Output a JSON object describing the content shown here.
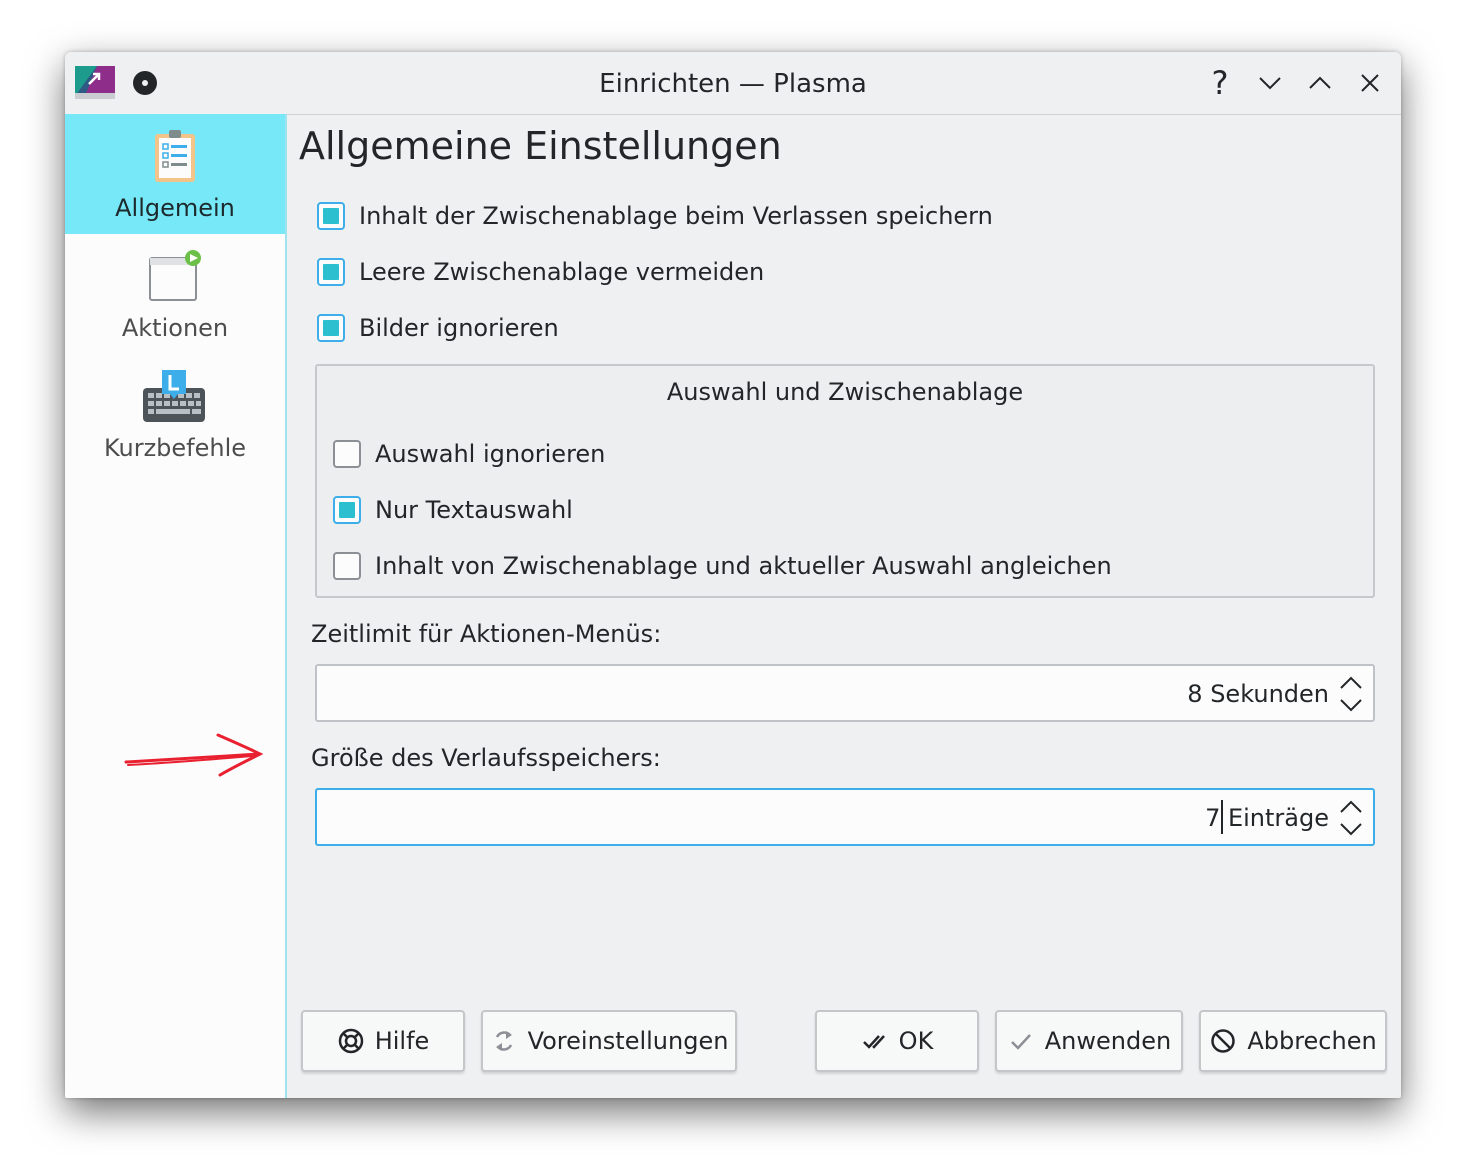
{
  "window": {
    "title": "Einrichten — Plasma",
    "help_glyph": "?"
  },
  "sidebar": {
    "items": [
      {
        "label": "Allgemein",
        "icon": "checklist-icon",
        "active": true
      },
      {
        "label": "Aktionen",
        "icon": "window-play-icon",
        "active": false
      },
      {
        "label": "Kurzbefehle",
        "icon": "keyboard-icon",
        "active": false
      }
    ]
  },
  "main": {
    "heading": "Allgemeine Einstellungen",
    "checkboxes": [
      {
        "label": "Inhalt der Zwischenablage beim Verlassen speichern",
        "checked": true
      },
      {
        "label": "Leere Zwischenablage vermeiden",
        "checked": true
      },
      {
        "label": "Bilder ignorieren",
        "checked": true
      }
    ],
    "group": {
      "title": "Auswahl und Zwischenablage",
      "checkboxes": [
        {
          "label": "Auswahl ignorieren",
          "checked": false
        },
        {
          "label": "Nur Textauswahl",
          "checked": true
        },
        {
          "label": "Inhalt von Zwischenablage und aktueller Auswahl angleichen",
          "checked": false
        }
      ]
    },
    "timeout": {
      "label": "Zeitlimit für Aktionen-Menüs:",
      "value": "8 Sekunden"
    },
    "history": {
      "label": "Größe des Verlaufsspeichers:",
      "value": "7 Einträge"
    }
  },
  "buttons": {
    "help": "Hilfe",
    "defaults": "Voreinstellungen",
    "ok": "OK",
    "apply": "Anwenden",
    "cancel": "Abbrechen"
  },
  "colors": {
    "accent": "#3daee9",
    "check_fill": "#2bbfd0",
    "sidebar_active": "#76e8f8",
    "annotation_arrow": "#e8202f"
  }
}
